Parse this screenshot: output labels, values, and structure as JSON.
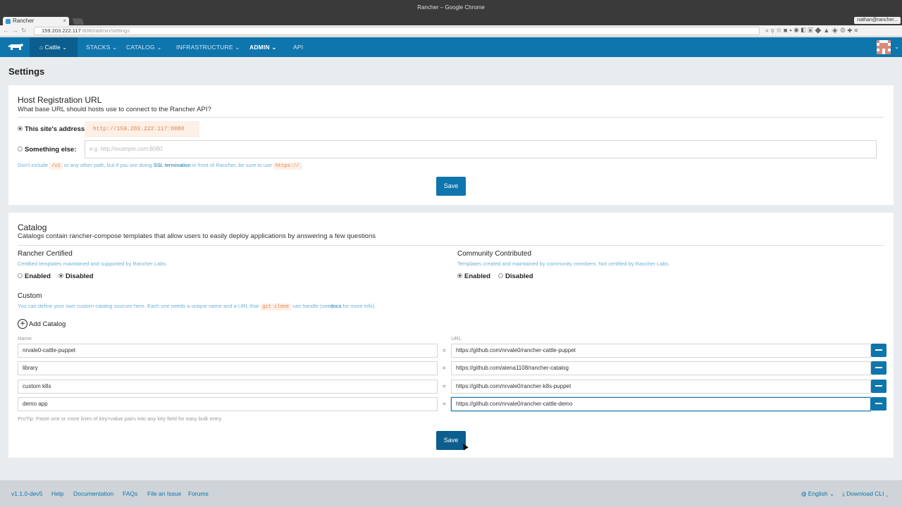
{
  "browser": {
    "window_title": "Rancher – Google Chrome",
    "tab_title": "Rancher",
    "profile": "nathan@rancher...",
    "url_host": "159.203.222.117",
    "url_rest": ":8080/admin/settings"
  },
  "header": {
    "environment": "Cattle",
    "nav": {
      "stacks": "STACKS",
      "catalog": "CATALOG",
      "infrastructure": "INFRASTRUCTURE",
      "admin": "ADMIN",
      "api": "API"
    }
  },
  "page_title": "Settings",
  "host_registration": {
    "title": "Host Registration URL",
    "subtitle": "What base URL should hosts use to connect to the Rancher API?",
    "this_site_label": "This site's address:",
    "this_site_value": "http://159.203.222.117:8080",
    "something_else_label": "Something else:",
    "something_else_placeholder": "e.g. http://example.com:8080",
    "help": {
      "p1": "Don't include",
      "code1": "/v1",
      "p2": "or any other path, but if you are doing",
      "link": "SSL termination",
      "p3": "in front of Rancher, be sure to use",
      "code2": "https://",
      "p4": "."
    },
    "save_label": "Save"
  },
  "catalog": {
    "title": "Catalog",
    "subtitle": "Catalogs contain rancher-compose templates that allow users to easily deploy applications by answering a few questions",
    "certified": {
      "title": "Rancher Certified",
      "desc": "Certified templates maintained and supported by Rancher Labs.",
      "enabled": "Enabled",
      "disabled": "Disabled"
    },
    "community": {
      "title": "Community Contributed",
      "desc": "Templates created and maintained by community members. Not certified by Rancher Labs.",
      "enabled": "Enabled",
      "disabled": "Disabled"
    },
    "custom": {
      "title": "Custom",
      "desc_p1": "You can define your own custom catalog sources here. Each one needs a unique name and a URL that",
      "desc_code": "git clone",
      "desc_p2": "can handle (see",
      "desc_link": "docs",
      "desc_p3": "for more info).",
      "add_label": "Add Catalog",
      "name_header": "Name",
      "url_header": "URL",
      "eq": "=",
      "rows": [
        {
          "name": "nrvale0-cattle-puppet",
          "url": "https://github.com/nrvale0/rancher-cattle-puppet"
        },
        {
          "name": "library",
          "url": "https://github.com/alena1108/rancher-catalog"
        },
        {
          "name": "custom k8s",
          "url": "https://github.com/nrvale0/rancher-k8s-puppet"
        },
        {
          "name": "demo app",
          "url": "https://github.com/nrvale0/rancher-cattle-demo"
        }
      ],
      "protip": "ProTip: Paste one or more lines of key=value pairs into any key field for easy bulk entry."
    },
    "save_label": "Save"
  },
  "footer": {
    "version": "v1.1.0-dev5",
    "help": "Help",
    "documentation": "Documentation",
    "faqs": "FAQs",
    "file_issue": "File an Issue",
    "forums": "Forums",
    "language": "English",
    "download": "Download CLI"
  },
  "colors": {
    "brand": "#0f75ad",
    "code_bg": "#fdf0e6",
    "code_fg": "#e0834a"
  }
}
